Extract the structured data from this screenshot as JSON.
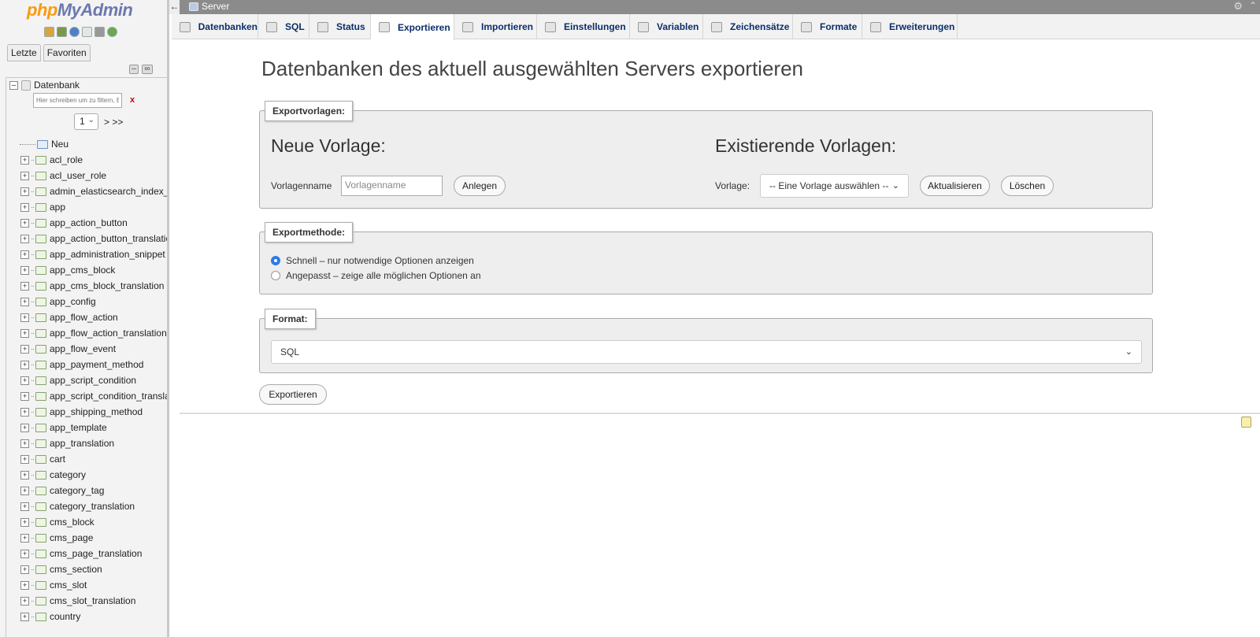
{
  "nav": {
    "logo": {
      "prefix": "php",
      "suffix": "MyAdmin"
    },
    "quick_icons": [
      "home-icon",
      "database-icon",
      "help-icon",
      "docs-icon",
      "settings-icon",
      "reload-icon"
    ],
    "tabs": [
      "Letzte",
      "Favoriten"
    ],
    "root": "Datenbank",
    "filter_placeholder": "Hier schreiben um zu filtern, E",
    "filter_clear": "x",
    "page_select": "1",
    "page_nav": "> >>",
    "new_label": "Neu",
    "tables": [
      "acl_role",
      "acl_user_role",
      "admin_elasticsearch_index_ta",
      "app",
      "app_action_button",
      "app_action_button_translatior",
      "app_administration_snippet",
      "app_cms_block",
      "app_cms_block_translation",
      "app_config",
      "app_flow_action",
      "app_flow_action_translation",
      "app_flow_event",
      "app_payment_method",
      "app_script_condition",
      "app_script_condition_translat",
      "app_shipping_method",
      "app_template",
      "app_translation",
      "cart",
      "category",
      "category_tag",
      "category_translation",
      "cms_block",
      "cms_page",
      "cms_page_translation",
      "cms_section",
      "cms_slot",
      "cms_slot_translation",
      "country"
    ]
  },
  "topbar": {
    "back": "←",
    "breadcrumb": "Server"
  },
  "tabs": [
    {
      "label": "Datenbanken",
      "icon": "database-icon"
    },
    {
      "label": "SQL",
      "icon": "sql-icon"
    },
    {
      "label": "Status",
      "icon": "status-icon"
    },
    {
      "label": "Exportieren",
      "icon": "export-icon"
    },
    {
      "label": "Importieren",
      "icon": "import-icon"
    },
    {
      "label": "Einstellungen",
      "icon": "wrench-icon"
    },
    {
      "label": "Variablen",
      "icon": "variables-icon"
    },
    {
      "label": "Zeichensätze",
      "icon": "charset-icon"
    },
    {
      "label": "Formate",
      "icon": "formats-icon"
    },
    {
      "label": "Erweiterungen",
      "icon": "puzzle-icon"
    }
  ],
  "main": {
    "title": "Datenbanken des aktuell ausgewählten Servers exportieren",
    "templates": {
      "legend": "Exportvorlagen:",
      "new_heading": "Neue Vorlage:",
      "name_label": "Vorlagenname",
      "name_placeholder": "Vorlagenname",
      "create_button": "Anlegen",
      "existing_heading": "Existierende Vorlagen:",
      "template_label": "Vorlage:",
      "template_select": "-- Eine Vorlage auswählen --",
      "update_button": "Aktualisieren",
      "delete_button": "Löschen"
    },
    "method": {
      "legend": "Exportmethode:",
      "option_quick": "Schnell – nur notwendige Optionen anzeigen",
      "option_custom": "Angepasst – zeige alle möglichen Optionen an",
      "selected": "quick"
    },
    "format": {
      "legend": "Format:",
      "selected": "SQL"
    },
    "export_button": "Exportieren"
  }
}
